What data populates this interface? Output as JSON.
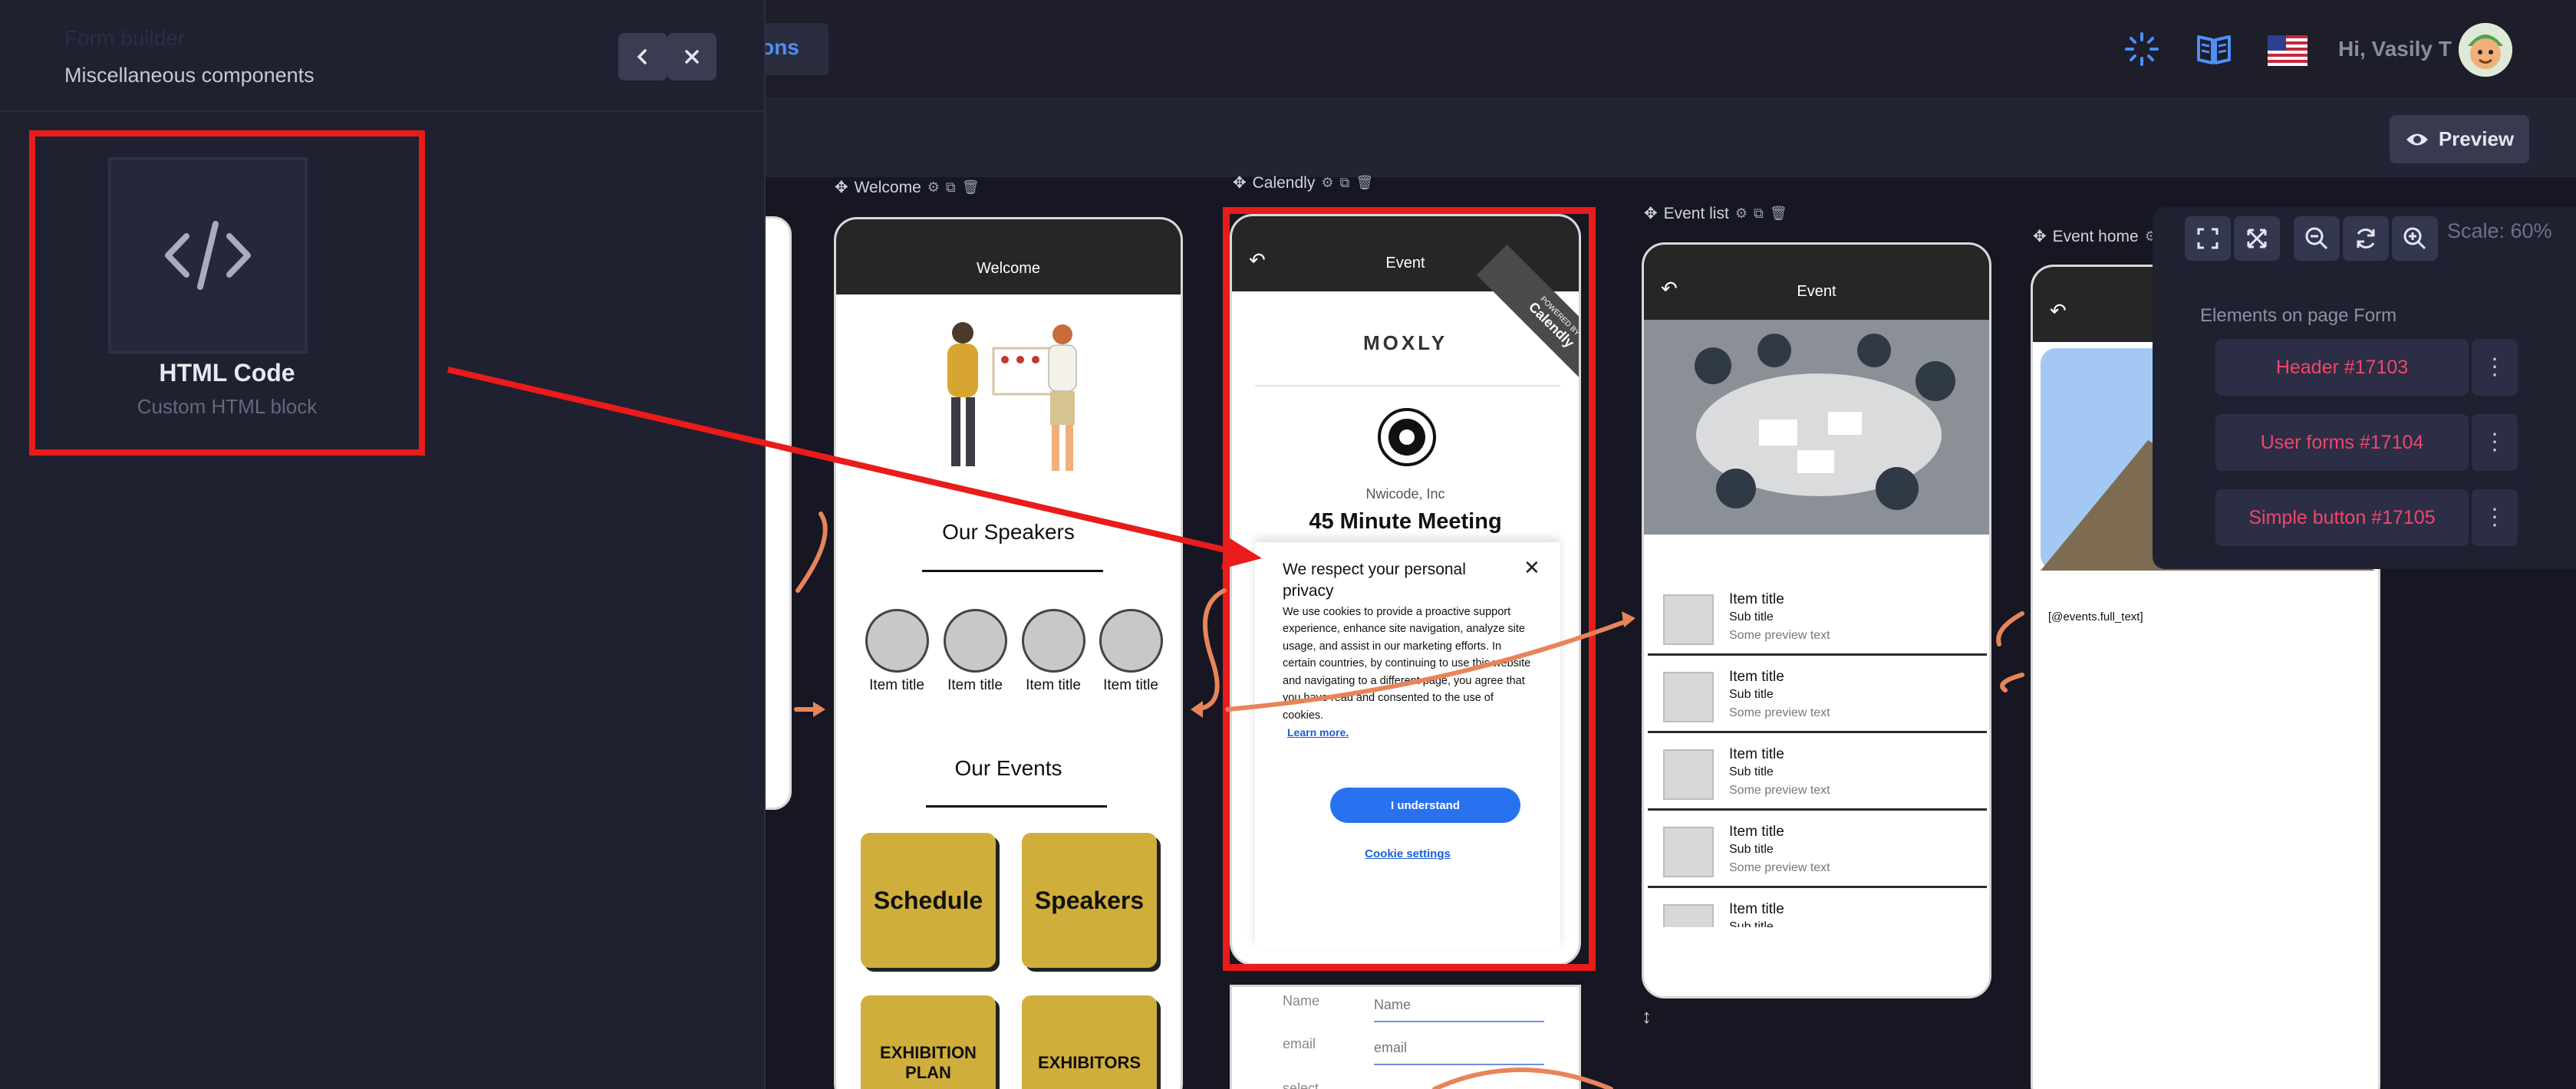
{
  "topbar": {
    "tab_fragment": "tions",
    "greeting": "Hi, Vasily T",
    "preview_label": "Preview"
  },
  "panel": {
    "ghost_title": "Form builder",
    "title": "Miscellaneous components",
    "card": {
      "title": "HTML Code",
      "subtitle": "Custom HTML block"
    }
  },
  "pages": {
    "welcome": {
      "label": "Welcome",
      "header": "Welcome",
      "speakers_heading": "Our Speakers",
      "item_title": "Item title",
      "events_heading": "Our Events",
      "tiles": [
        "Schedule",
        "Speakers",
        "EXHIBITION PLAN",
        "EXHIBITORS"
      ]
    },
    "calendly": {
      "label": "Calendly",
      "header": "Event",
      "brand": "MOXLY",
      "ribbon_top": "POWERED BY",
      "ribbon": "Calendly",
      "company": "Nwicode, Inc",
      "meeting": "45 Minute Meeting",
      "cookie": {
        "title": "We respect your personal privacy",
        "body": "We use cookies to provide a proactive support experience, enhance site navigation, analyze site usage, and assist in our marketing efforts. In certain countries, by continuing to use this website and navigating to a different page, you agree that you have read and consented to the use of cookies.",
        "link": "Learn more.",
        "button": "I understand",
        "settings": "Cookie settings"
      },
      "form": {
        "name_label": "Name",
        "name_placeholder": "Name",
        "email_label": "email",
        "email_placeholder": "email",
        "select_label": "select"
      }
    },
    "event_list": {
      "label": "Event list",
      "header": "Event",
      "rows": [
        {
          "title": "Item title",
          "sub": "Sub title",
          "preview": "Some preview text"
        },
        {
          "title": "Item title",
          "sub": "Sub title",
          "preview": "Some preview text"
        },
        {
          "title": "Item title",
          "sub": "Sub title",
          "preview": "Some preview text"
        },
        {
          "title": "Item title",
          "sub": "Sub title",
          "preview": "Some preview text"
        },
        {
          "title": "Item title",
          "sub": "Sub title",
          "preview": ""
        }
      ]
    },
    "event_home": {
      "label": "Event home",
      "template_text": "[@events.full_text]"
    }
  },
  "zoom": {
    "scale": "Scale: 60%",
    "elements_heading": "Elements on page Form",
    "elements": [
      "Header #17103",
      "User forms #17104",
      "Simple button #17105"
    ]
  },
  "colors": {
    "accent": "#4e8ef7",
    "highlight": "#ea1b1b",
    "tile": "#cfae3b",
    "element_text": "#f0466c",
    "arrow_orange": "#e8845a"
  }
}
